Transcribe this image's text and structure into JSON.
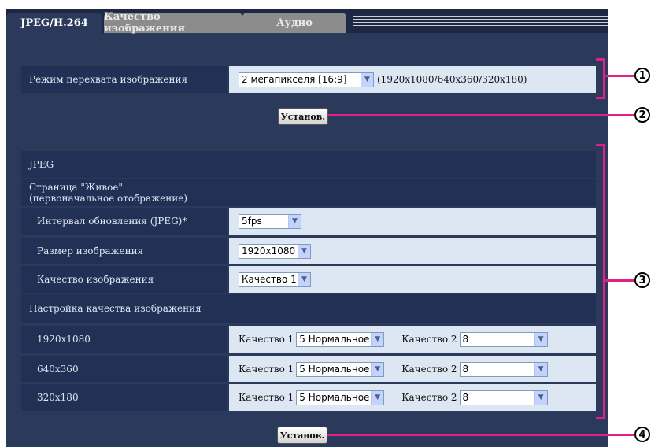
{
  "tabs": [
    "JPEG/H.264",
    "Качество изображения",
    "Аудио"
  ],
  "capture": {
    "label": "Режим перехвата изображения",
    "value": "2 мегапикселя [16:9]",
    "note": "(1920x1080/640x360/320x180)"
  },
  "set_button": "Установ.",
  "jpeg": {
    "section_label": "JPEG",
    "live_label": "Страница \"Живое\" (первоначальное отображение)",
    "interval": {
      "label": "Интервал обновления (JPEG)*",
      "value": "5fps"
    },
    "size": {
      "label": "Размер изображения",
      "value": "1920x1080"
    },
    "quality": {
      "label": "Качество изображения",
      "value": "Качество 1"
    },
    "quality_setting_label": "Настройка качества изображения",
    "rows": [
      {
        "res": "1920x1080",
        "q1_label": "Качество 1",
        "q1_value": "5 Нормальное",
        "q2_label": "Качество 2",
        "q2_value": "8"
      },
      {
        "res": "640x360",
        "q1_label": "Качество 1",
        "q1_value": "5 Нормальное",
        "q2_label": "Качество 2",
        "q2_value": "8"
      },
      {
        "res": "320x180",
        "q1_label": "Качество 1",
        "q1_value": "5 Нормальное",
        "q2_label": "Качество 2",
        "q2_value": "8"
      }
    ]
  },
  "callouts": [
    "1",
    "2",
    "3",
    "4"
  ],
  "colors": {
    "panel": "#2b3a5a",
    "label_bg": "#223055",
    "value_bg": "#dde6f3",
    "callout_line": "#e0218a"
  }
}
